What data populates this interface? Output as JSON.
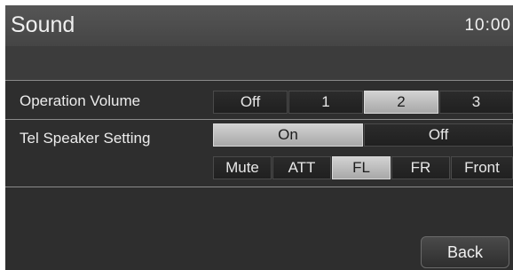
{
  "header": {
    "title": "Sound",
    "time": "10:00"
  },
  "operation_volume": {
    "label": "Operation Volume",
    "options": [
      "Off",
      "1",
      "2",
      "3"
    ],
    "selected": "2"
  },
  "tel_speaker": {
    "label": "Tel Speaker Setting",
    "toggle": [
      "On",
      "Off"
    ],
    "selected_toggle": "On",
    "speakers": [
      "Mute",
      "ATT",
      "FL",
      "FR",
      "Front"
    ],
    "selected_speaker": "FL"
  },
  "footer": {
    "back_label": "Back"
  }
}
